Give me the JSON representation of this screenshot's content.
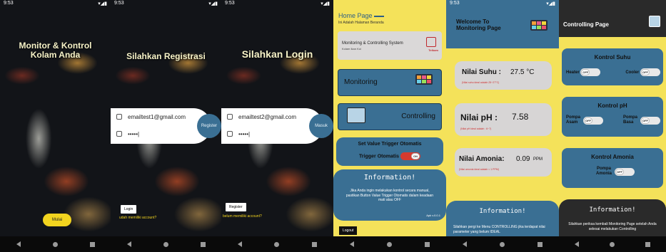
{
  "status_time": "9:53",
  "screen1": {
    "title_line1": "Monitor & Kontrol",
    "title_line2": "Kolam Anda",
    "button": "Mulai"
  },
  "screen2": {
    "title": "Silahkan Registrasi",
    "email": "emailtest1@gmail.com",
    "password": "•••••|",
    "circle_button": "Register",
    "login_button": "Login",
    "link": "udah memiliki account?"
  },
  "screen3": {
    "title": "Silahkan Login",
    "email": "emailtest2@gmail.com",
    "password": "•••••|",
    "circle_button": "Masuk",
    "register_button": "Register",
    "link": "belum memiliki account?"
  },
  "screen4": {
    "title": "Home Page",
    "subtitle": "Ini Adalah Halaman Beranda",
    "system_title": "Monitoring & Controlling System",
    "system_sub": "Kolam Ikan Koi",
    "logo_text": "Telkom",
    "monitoring": "Monitoring",
    "controlling": "Controlling",
    "trigger_title": "Set Value Trigger Otomatis",
    "trigger_label": "Trigger Otomatis",
    "trigger_state": "ON",
    "info_title": "Information!",
    "info_text": "Jika Anda ingin melakukan kontrol secara manual, pastikan Button Value Trigger Otomatis dalam keadaan mati atau OFF",
    "version": "Apk v.0.0.1",
    "logout": "Logout"
  },
  "screen5": {
    "welcome": "Welcome To Monitoring Page",
    "suhu_label": "Nilai Suhu :",
    "suhu_value": "27.5 °C",
    "suhu_note": "(Nilai suhu ideal adalah 25~27°C)",
    "ph_label": "Nilai pH :",
    "ph_value": "7.58",
    "ph_note": "(Nilai pH ideal adalah : 6~7)",
    "amonia_label": "Nilai Amonia:",
    "amonia_value": "0.09",
    "amonia_unit": "PPM",
    "amonia_note": "(Nilai amonia ideal adalah < 1 PPM)",
    "info_title": "Information!",
    "info_text": "Silahkan pergi ke Menu CONTROLLING jika terdapat nilai parameter yang belum IDEAL"
  },
  "screen6": {
    "title": "Controlling Page",
    "suhu_title": "Kontrol Suhu",
    "heater": "Heater",
    "cooler": "Cooler",
    "ph_title": "Kontrol pH",
    "pompa_asam": "Pompa Asam",
    "pompa_basa": "Pompa Basa",
    "amonia_title": "Kontrol Amonia",
    "pompa_amonia": "Pompa Amonia",
    "off": "OFF",
    "info_title": "Information!",
    "info_text": "Silahkan periksa kembali Monitoring Page setelah Anda selesai melakukan Controlling"
  },
  "colors": {
    "blue": "#3a6f93",
    "yellow": "#f4e25a",
    "toggle_on": "#d63a2f"
  }
}
